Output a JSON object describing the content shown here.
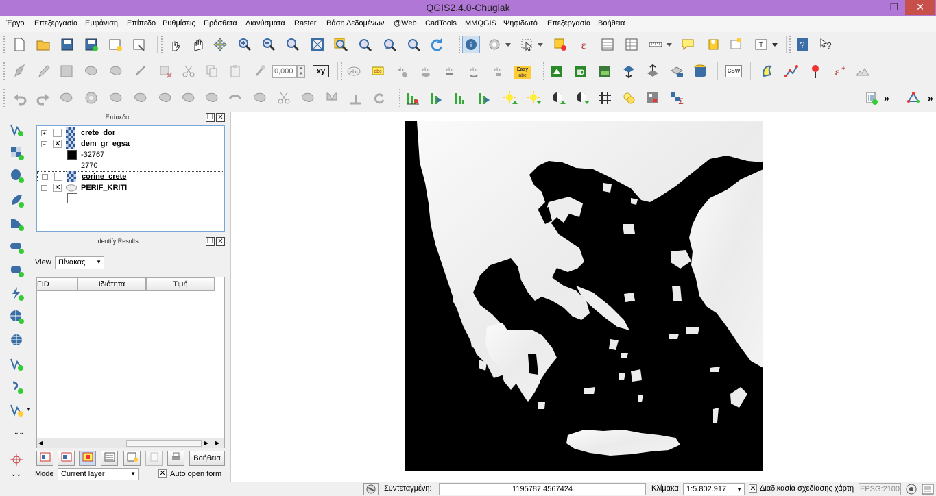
{
  "window": {
    "title": "QGIS2.4.0-Chugiak",
    "minimize": "—",
    "maximize": "❐",
    "close": "✕"
  },
  "menu": [
    "Έργο",
    "Επεξεργασία",
    "Εμφάνιση",
    "Επίπεδο",
    "Ρυθμίσεις",
    "Πρόσθετα",
    "Διανύσματα",
    "Raster",
    "Βάση Δεδομένων",
    "@Web",
    "CadTools",
    "MMQGIS",
    "Ψηφιδωτό",
    "Επεξεργασία",
    "Βοήθεια"
  ],
  "toolbar": {
    "rotation_value": "0,000",
    "xy_label": "xy",
    "csw_label": "CSW",
    "easy_label": "Easy",
    "overflow": "»"
  },
  "layers_panel": {
    "title": "Επίπεδα",
    "layers": [
      {
        "name": "crete_dor",
        "checked": false,
        "expanded": false,
        "type": "raster"
      },
      {
        "name": "dem_gr_egsa",
        "checked": true,
        "expanded": true,
        "type": "raster",
        "legend": [
          "-32767",
          "2770"
        ]
      },
      {
        "name": "corine_crete",
        "checked": false,
        "expanded": false,
        "type": "raster"
      },
      {
        "name": "PERIF_KRITI",
        "checked": true,
        "expanded": true,
        "type": "vector"
      }
    ]
  },
  "identify_panel": {
    "title": "Identify Results",
    "view_label": "View",
    "view_value": "Πίνακας",
    "columns": [
      "FID",
      "Ιδιότητα",
      "Τιμή"
    ],
    "help_button": "Βοήθεια",
    "mode_label": "Mode",
    "mode_value": "Current layer",
    "auto_open_label": "Auto open form",
    "auto_open_checked": true
  },
  "statusbar": {
    "coord_label": "Συντεταγμένη:",
    "coord_value": "1195787,4567424",
    "scale_label": "Κλίμακα",
    "scale_value": "1:5.802.917",
    "render_label": "Διαδικασία σχεδίασης χάρτη",
    "crs": "EPSG:2100"
  },
  "colors": {
    "titlebar": "#b177d6",
    "close": "#c7504b",
    "land": "#ececec",
    "sea": "#000000"
  }
}
